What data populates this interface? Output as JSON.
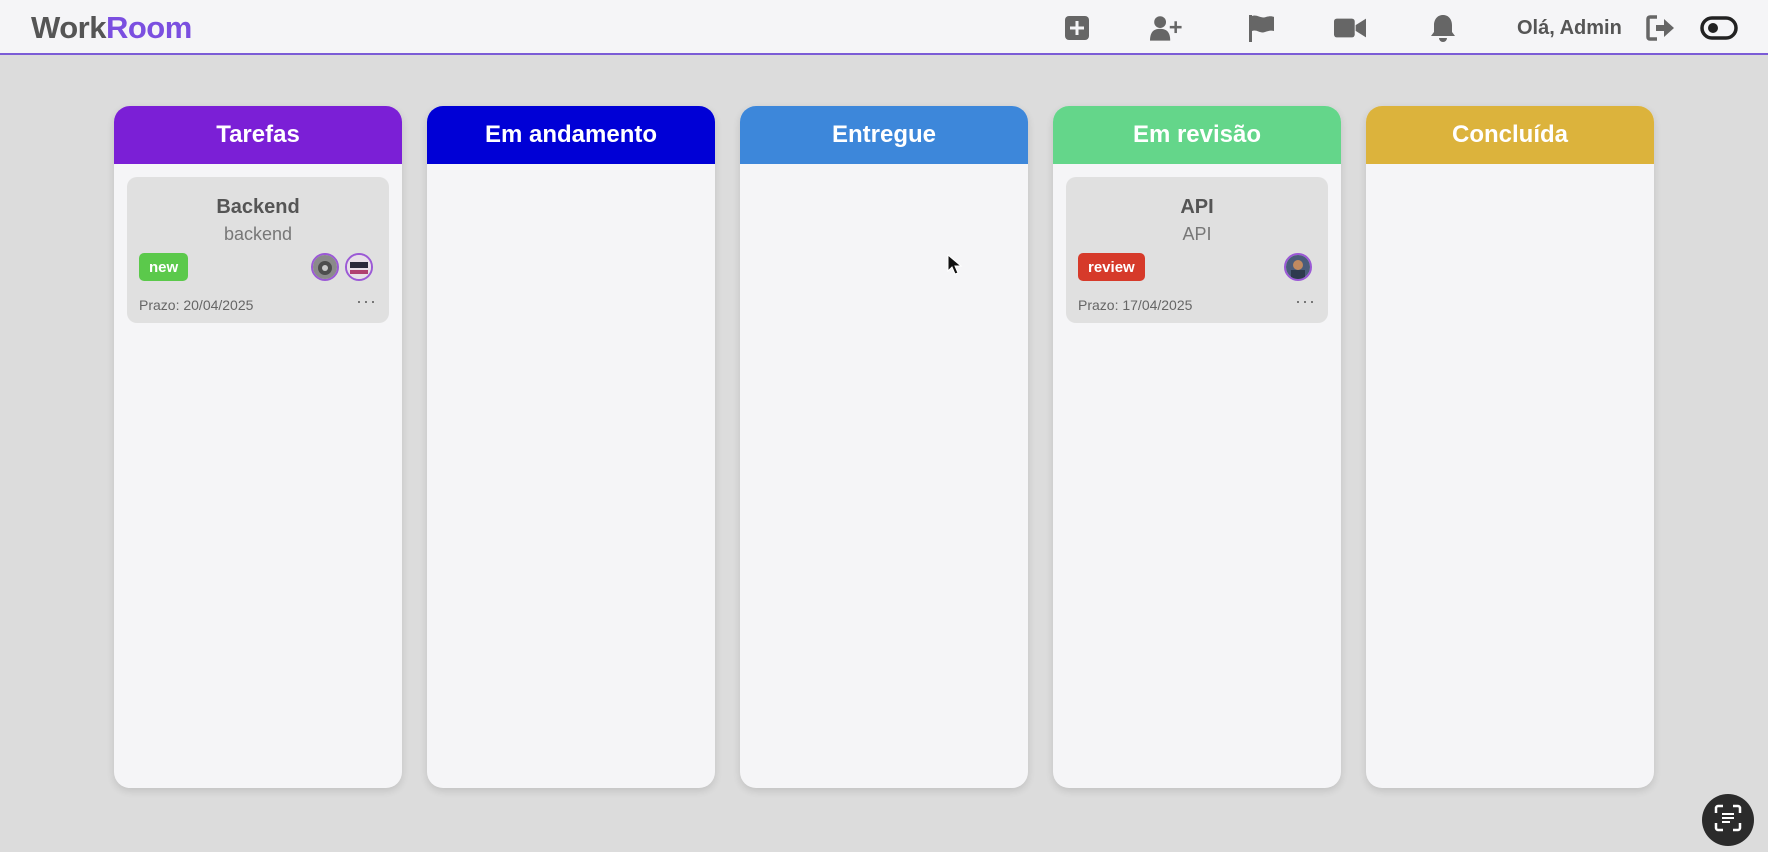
{
  "header": {
    "logo_part1": "Work",
    "logo_part2": "Room",
    "greeting": "Olá, Admin",
    "icons": [
      "add-square-icon",
      "add-user-icon",
      "flag-icon",
      "video-icon",
      "bell-icon",
      "logout-icon",
      "theme-toggle-icon"
    ]
  },
  "columns": [
    {
      "title": "Tarefas",
      "color": "#7b1fd6"
    },
    {
      "title": "Em andamento",
      "color": "#0000d6"
    },
    {
      "title": "Entregue",
      "color": "#3d87da"
    },
    {
      "title": "Em revisão",
      "color": "#64d68a"
    },
    {
      "title": "Concluída",
      "color": "#dcb33c"
    }
  ],
  "cards": {
    "backend": {
      "title": "Backend",
      "subtitle": "backend",
      "tag": "new",
      "tag_color": "#5bc94b",
      "deadline": "Prazo: 20/04/2025",
      "more": "···"
    },
    "api": {
      "title": "API",
      "subtitle": "API",
      "tag": "review",
      "tag_color": "#d63a2a",
      "deadline": "Prazo: 17/04/2025",
      "more": "···"
    }
  },
  "fab_icon": "scan-text-icon"
}
